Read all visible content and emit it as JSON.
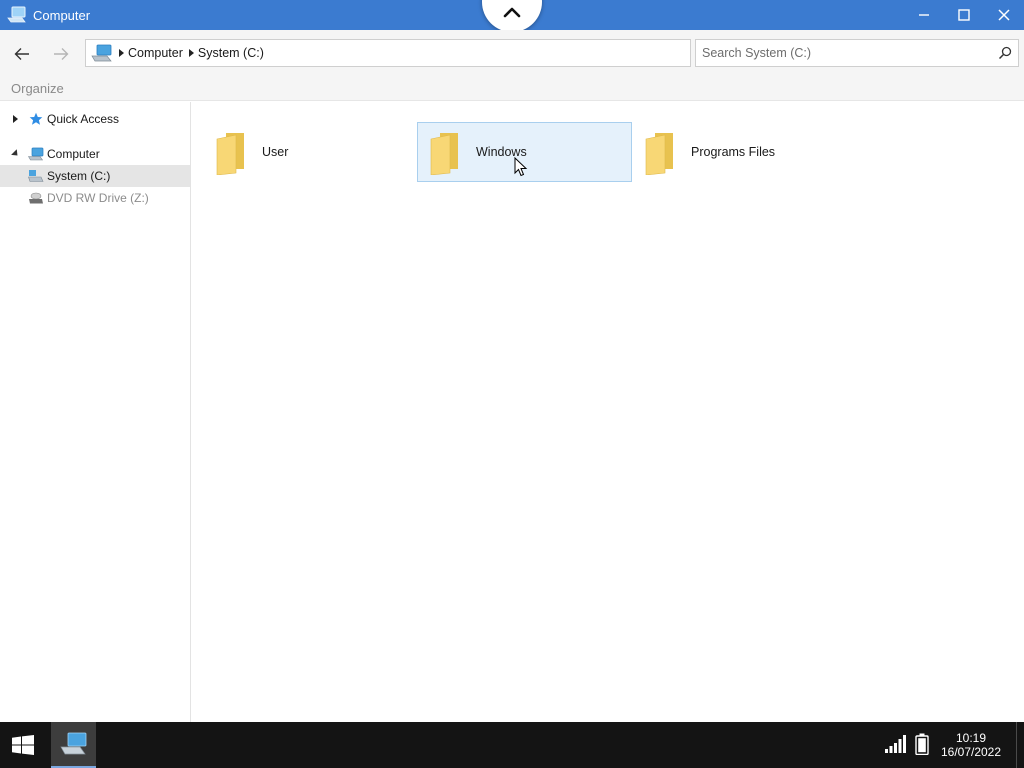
{
  "window": {
    "title": "Computer",
    "icon": "computer-icon",
    "controls": [
      "minimize-icon",
      "maximize-icon",
      "close-icon"
    ],
    "collapse_icon": "chevron-up-icon"
  },
  "address": {
    "back_icon": "arrow-left-icon",
    "forward_icon": "arrow-right-icon",
    "crumbs": [
      "Computer",
      "System (C:)"
    ],
    "search_placeholder": "Search System (C:)",
    "search_icon": "search-icon"
  },
  "toolbar": {
    "organize_label": "Organize"
  },
  "sidebar": {
    "items": [
      {
        "label": "Quick Access",
        "icon": "star-icon",
        "expander": "collapsed"
      },
      {
        "label": "Computer",
        "icon": "computer-icon",
        "expander": "expanded"
      },
      {
        "label": "System (C:)",
        "icon": "drive-icon",
        "selected": true
      },
      {
        "label": "DVD RW Drive (Z:)",
        "icon": "dvd-drive-icon",
        "disabled": true
      }
    ]
  },
  "content": {
    "folders": [
      {
        "label": "User",
        "icon": "folder-icon"
      },
      {
        "label": "Windows",
        "icon": "folder-icon",
        "hovered": true
      },
      {
        "label": "Programs Files",
        "icon": "folder-icon"
      }
    ]
  },
  "taskbar": {
    "start_icon": "windows-logo-icon",
    "app_icon": "computer-icon",
    "signal_icon": "signal-icon",
    "battery_icon": "battery-icon",
    "time": "10:19",
    "date": "16/07/2022"
  },
  "colors": {
    "titlebar": "#3b7bd0",
    "taskbar": "#141414",
    "hover_fill": "#e5f1fb",
    "hover_border": "#a9cfee",
    "folder": "#f8d775"
  }
}
